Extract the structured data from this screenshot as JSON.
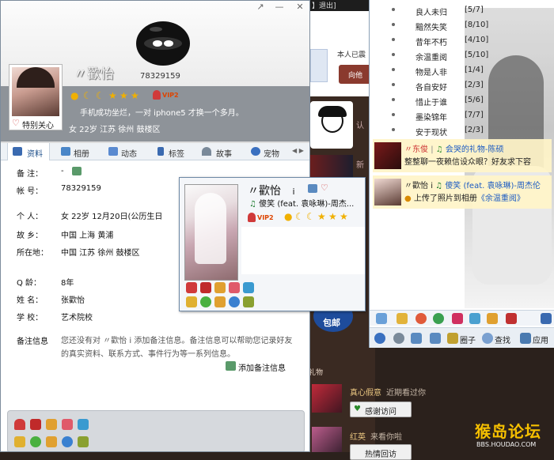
{
  "profile": {
    "nickname": "〃歡怡",
    "qq_number": "78329159",
    "window_buttons": [
      "↗",
      "—",
      "✕"
    ],
    "care_label": "特别关心",
    "vip_badge": "VIP2",
    "signature": "手机成功坐烂，一对 iphone5 才换一个多月。",
    "basic_line": "女   22岁    江苏 徐州 鼓楼区",
    "tabs": [
      "资料",
      "相册",
      "动态",
      "标签",
      "故事",
      "宠物"
    ],
    "tab_arrows": "◀ ▶",
    "info": {
      "remark_label": "备    注：",
      "remark_value": "-",
      "account_label": "帐    号：",
      "account_value": "78329159",
      "personal_label": "个    人：",
      "personal_value": "女    22岁    12月20日(公历生日",
      "hometown_label": "故    乡：",
      "hometown_value": "中国 上海 黄浦",
      "location_label": "所在地：",
      "location_value": "中国 江苏 徐州 鼓楼区",
      "qage_label": "Q     龄：",
      "qage_value": "8年",
      "name_label": "姓    名：",
      "name_value": "张歡怡",
      "school_label": "学    校：",
      "school_value": "艺术院校",
      "remark_info_label": "备注信息",
      "remark_info_text": "您还没有对 〃歡怡   i 添加备注信息。备注信息可以帮助您记录好友的真实资料、联系方式、事件行为等一系列信息。",
      "add_remark": "添加备注信息"
    }
  },
  "card": {
    "name": "〃歡怡",
    "name_suffix": "i",
    "song": "傻笑 (feat. 袁咏琳)-周杰...",
    "vip_badge": "VIP2"
  },
  "right_panel": {
    "friends": [
      {
        "name": "良人未归",
        "count": "[5/7]"
      },
      {
        "name": "黯然失笑",
        "count": "[8/10]"
      },
      {
        "name": "昔年不朽",
        "count": "[4/10]"
      },
      {
        "name": "余温重阅",
        "count": "[5/10]"
      },
      {
        "name": "物是人非",
        "count": "[1/4]"
      },
      {
        "name": "各自安好",
        "count": "[2/3]"
      },
      {
        "name": "惜止于谁",
        "count": "[5/6]"
      },
      {
        "name": "墨染锦年",
        "count": "[7/7]"
      },
      {
        "name": "安于现状",
        "count": "[2/3]"
      }
    ],
    "feed1": {
      "name": "〃东俊",
      "song": "会哭的礼物-陈硕",
      "status": "整整聊一夜赖信设众眼？好友求下容"
    },
    "feed2": {
      "name": "〃歡怡",
      "suffix": "i",
      "song": "傻笑 (feat. 袁咏琳)-周杰伦",
      "status_prefix": "上传了照片到相册",
      "album": "《余温重阅》"
    },
    "toolbar": {
      "circle": "圈子",
      "search": "查找",
      "apps": "应用"
    }
  },
  "background_app": {
    "top_text": "】退出]",
    "user_text": "本人已震",
    "button_text": "向他",
    "side_char": "认",
    "side_char2": "新",
    "baoyou": "包邮",
    "label_li": "礼物",
    "visitors": [
      {
        "name": "真心假意",
        "note": "近期看过你",
        "button": "感谢访问"
      },
      {
        "name": "红英",
        "note": "来看你啦",
        "button": "热情回访"
      }
    ]
  },
  "watermark": {
    "big": "猴岛论坛",
    "small": "BBS.HOUDAO.COM"
  },
  "colors": {
    "accent": "#1d4f8a",
    "header_gray": "#8e9399",
    "vip": "#dd4400",
    "watermark": "#f6c000"
  }
}
